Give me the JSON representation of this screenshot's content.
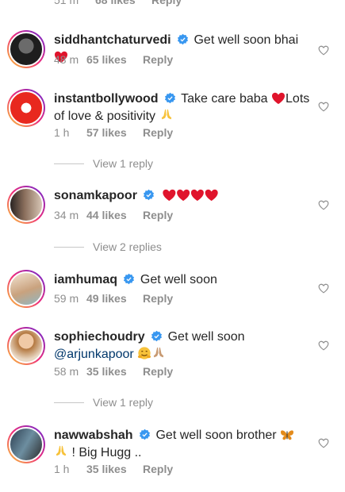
{
  "top": {
    "time": "51 m",
    "likes": "68 likes",
    "reply": "Reply"
  },
  "comments": [
    {
      "username": "siddhantchaturvedi",
      "text": "Get well soon bhai",
      "time": "48 m",
      "likes": "65 likes",
      "reply": "Reply",
      "avatar_color": "#2a2a2a"
    },
    {
      "username": "instantbollywood",
      "text_a": "Take care baba",
      "text_b": "Lots of love & positivity",
      "time": "1 h",
      "likes": "57 likes",
      "reply": "Reply",
      "view_replies": "View 1 reply",
      "avatar_color": "#e8281f"
    },
    {
      "username": "sonamkapoor",
      "time": "34 m",
      "likes": "44 likes",
      "reply": "Reply",
      "view_replies": "View 2 replies",
      "avatar_color": "#5a4638"
    },
    {
      "username": "iamhumaq",
      "text": "Get well soon",
      "time": "59 m",
      "likes": "49 likes",
      "reply": "Reply",
      "avatar_color": "#d9b99b"
    },
    {
      "username": "sophiechoudry",
      "text": "Get well soon",
      "mention": "@arjunkapoor",
      "time": "58 m",
      "likes": "35 likes",
      "reply": "Reply",
      "view_replies": "View 1 reply",
      "avatar_color": "#c98a5a"
    },
    {
      "username": "nawwabshah",
      "text_a": "Get well soon brother",
      "text_b": "! Big Hugg ..",
      "time": "1 h",
      "likes": "35 likes",
      "reply": "Reply",
      "avatar_color": "#4a6a7a"
    }
  ],
  "colors": {
    "verified": "#3897f0",
    "heart_red": "#e0142c",
    "muted": "#8e8e8e",
    "mention": "#00376b"
  },
  "icons": {
    "verified": "verified-badge-icon",
    "like": "heart-outline-icon"
  }
}
